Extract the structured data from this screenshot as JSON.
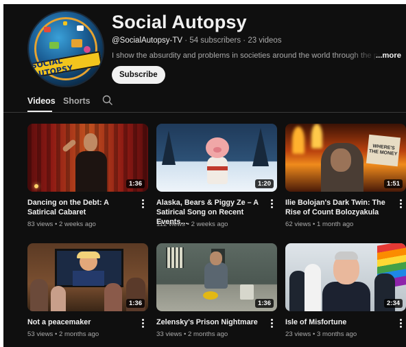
{
  "channel": {
    "name": "Social Autopsy",
    "handle": "@SocialAutopsy-TV",
    "subscribers": "54 subscribers",
    "videos": "23 videos",
    "separator": " · ",
    "description": "I show the absurdity and problems in societies around the world through the prism of sa",
    "more_label": "...more",
    "subscribe_label": "Subscribe",
    "avatar_text": "SOCIAL AUTOPSY"
  },
  "tabs": [
    {
      "label": "Videos",
      "active": true
    },
    {
      "label": "Shorts",
      "active": false
    }
  ],
  "videos": [
    {
      "title": "Dancing on the Debt: A Satirical Cabaret",
      "views": "83 views",
      "age": "2 weeks ago",
      "duration": "1:36",
      "thumb": "stage-performer"
    },
    {
      "title": "Alaska, Bears & Piggy Ze – A Satirical Song on Recent Events…",
      "views": "112 views",
      "age": "2 weeks ago",
      "duration": "1:20",
      "thumb": "pig-in-snow"
    },
    {
      "title": "Ilie Bolojan's Dark Twin: The Rise of Count Bolozyakula",
      "views": "62 views",
      "age": "1 month ago",
      "duration": "1:51",
      "thumb": "man-with-sign-fire",
      "sign_text": "WHERE'S THE MONEY"
    },
    {
      "title": "Not a peacemaker",
      "views": "53 views",
      "age": "2 months ago",
      "duration": "1:36",
      "thumb": "tv-audience"
    },
    {
      "title": "Zelensky's Prison Nightmare",
      "views": "33 views",
      "age": "2 months ago",
      "duration": "1:36",
      "thumb": "prison-cell"
    },
    {
      "title": "Isle of Misfortune",
      "views": "23 views",
      "age": "3 months ago",
      "duration": "2:34",
      "thumb": "smiling-man-crowd"
    }
  ],
  "meta_separator": " • ",
  "colors": {
    "background": "#0f0f0f",
    "text": "#f1f1f1",
    "secondary": "#aaaaaa",
    "subscribe_bg": "#f1f1f1"
  }
}
